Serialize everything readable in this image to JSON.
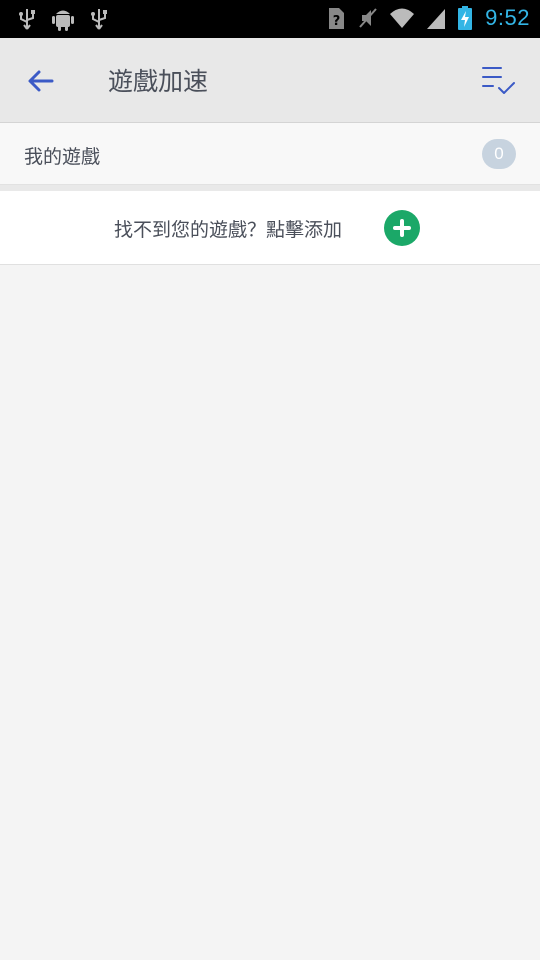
{
  "status_bar": {
    "time": "9:52",
    "icons": [
      "usb-icon",
      "android-debug-icon",
      "usb-icon",
      "no-sim-icon",
      "mute-icon",
      "wifi-icon",
      "signal-icon",
      "battery-charging-icon"
    ]
  },
  "header": {
    "title": "遊戲加速",
    "back_icon": "arrow-left-icon",
    "sort_icon": "checklist-icon"
  },
  "my_games": {
    "label": "我的遊戲",
    "count": "0"
  },
  "add_game": {
    "text": "找不到您的遊戲？點擊添加",
    "icon": "plus-circle-icon"
  },
  "colors": {
    "accent_blue": "#3b5ac6",
    "add_green": "#1ba868",
    "badge_bg": "#c7d3df",
    "clock_blue": "#33b5e5"
  }
}
